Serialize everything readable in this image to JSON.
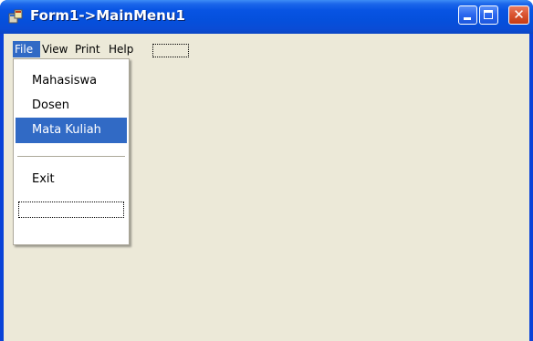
{
  "window": {
    "title": "Form1->MainMenu1",
    "close_glyph": "✕"
  },
  "icons": {
    "app": "form-app-icon",
    "minimize": "minimize-icon",
    "maximize": "maximize-icon",
    "close": "close-icon"
  },
  "menubar": {
    "items": [
      {
        "label": "File",
        "active": true
      },
      {
        "label": "View"
      },
      {
        "label": "Print"
      },
      {
        "label": "Help"
      }
    ]
  },
  "file_menu": {
    "items": [
      {
        "label": "Mahasiswa"
      },
      {
        "label": "Dosen"
      },
      {
        "label": "Mata Kuliah",
        "selected": true
      }
    ],
    "exit_label": "Exit"
  },
  "colors": {
    "title_bar": "#0854e3",
    "highlight": "#316ac5",
    "client_bg": "#ece9d8",
    "close_button": "#d9532f"
  }
}
